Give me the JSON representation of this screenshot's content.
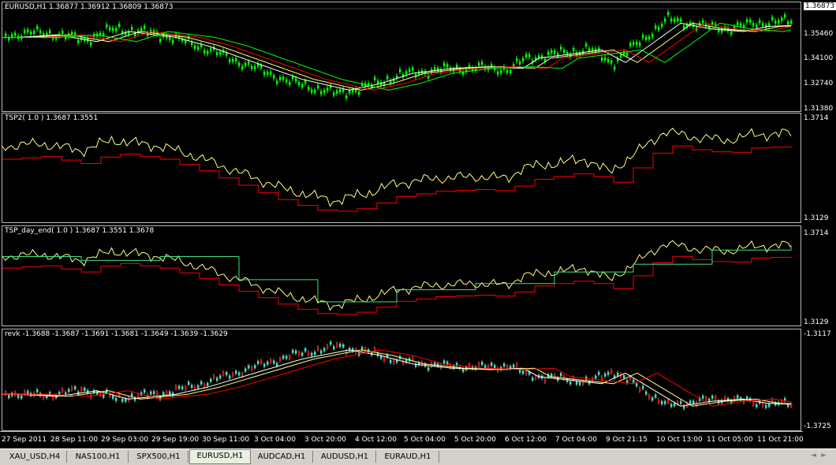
{
  "panes": [
    {
      "label": "EURUSD,H1  1.36877 1.36912 1.36809 1.36873",
      "price_labels": [
        "1.36873",
        "1.35460",
        "1.34100",
        "1.32740",
        "1.31380"
      ]
    },
    {
      "label": "TSP2( 1.0 ) 1.3687 1.3551",
      "price_labels": [
        "1.3714",
        "1.3129"
      ]
    },
    {
      "label": "TSP_day_end( 1.0 ) 1.3687 1.3551 1.3678",
      "price_labels": [
        "1.3714",
        "1.3129"
      ]
    },
    {
      "label": "revk -1.3688 -1.3687 -1.3691 -1.3681 -1.3649 -1.3639 -1.3629",
      "price_labels": [
        "-1.3117",
        "-1.3725"
      ]
    }
  ],
  "time_labels": [
    "27 Sep 2011",
    "28 Sep 11:00",
    "29 Sep 03:00",
    "29 Sep 19:00",
    "30 Sep 11:00",
    "3 Oct 04:00",
    "3 Oct 20:00",
    "4 Oct 12:00",
    "5 Oct 04:00",
    "5 Oct 20:00",
    "6 Oct 12:00",
    "7 Oct 04:00",
    "9 Oct 21:15",
    "10 Oct 13:00",
    "11 Oct 05:00",
    "11 Oct 21:00"
  ],
  "tabs": [
    "XAU_USD,H4",
    "NAS100,H1",
    "SPX500,H1",
    "EURUSD,H1",
    "AUDCAD,H1",
    "AUDUSD,H1",
    "EURAUD,H1"
  ],
  "active_tab": "EURUSD,H1",
  "scroll_arrows": "◄►",
  "colors": {
    "bull": "#00ff00",
    "bear": "#00ff00",
    "white_line": "#ffffff",
    "red_line": "#ff0000",
    "green_line": "#00ff00",
    "yellow_line": "#ffff80",
    "teal": "#40e0c0",
    "step_green": "#40e080"
  }
}
